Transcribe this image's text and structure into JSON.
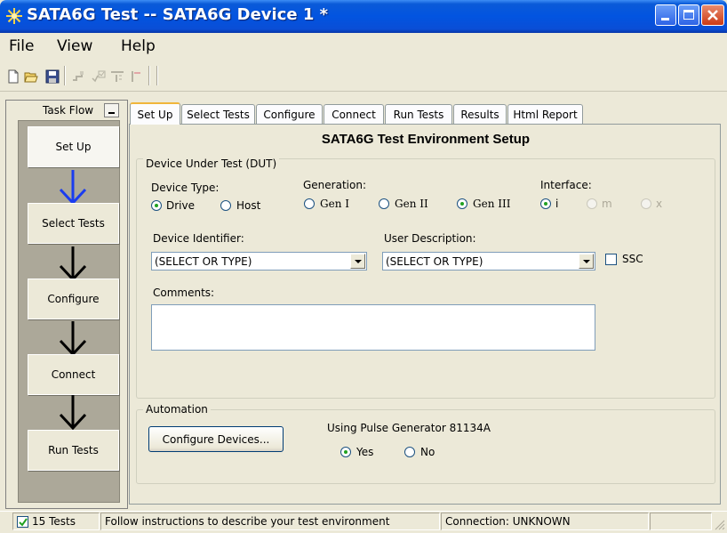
{
  "window": {
    "title": "SATA6G Test -- SATA6G Device 1 *"
  },
  "menu": {
    "file": "File",
    "view": "View",
    "help": "Help"
  },
  "task_flow": {
    "title": "Task Flow",
    "steps": [
      "Set Up",
      "Select Tests",
      "Configure",
      "Connect",
      "Run Tests"
    ]
  },
  "tabs": [
    "Set Up",
    "Select Tests",
    "Configure",
    "Connect",
    "Run Tests",
    "Results",
    "Html Report"
  ],
  "setup": {
    "heading": "SATA6G Test Environment Setup",
    "dut_legend": "Device Under Test (DUT)",
    "device_type_label": "Device Type:",
    "device_type_options": [
      "Drive",
      "Host"
    ],
    "device_type_selected": "Drive",
    "generation_label": "Generation:",
    "generation_options": [
      "Gen I",
      "Gen II",
      "Gen III"
    ],
    "generation_selected": "Gen III",
    "interface_label": "Interface:",
    "interface_options": [
      "i",
      "m",
      "x"
    ],
    "interface_selected": "i",
    "device_identifier_label": "Device Identifier:",
    "device_identifier_value": "(SELECT OR TYPE)",
    "user_description_label": "User Description:",
    "user_description_value": "(SELECT OR TYPE)",
    "ssc_label": "SSC",
    "comments_label": "Comments:",
    "comments_value": "",
    "automation_legend": "Automation",
    "configure_devices_button": "Configure Devices...",
    "pulse_generator_label": "Using Pulse Generator 81134A",
    "pulse_options": [
      "Yes",
      "No"
    ],
    "pulse_selected": "Yes"
  },
  "status": {
    "tests": "15 Tests",
    "message": "Follow instructions to describe your test environment",
    "connection": "Connection: UNKNOWN"
  },
  "colors": {
    "titlebar": "#0254e0",
    "flow_arrow_active": "#1a3cf0",
    "flow_arrow": "#000000"
  }
}
